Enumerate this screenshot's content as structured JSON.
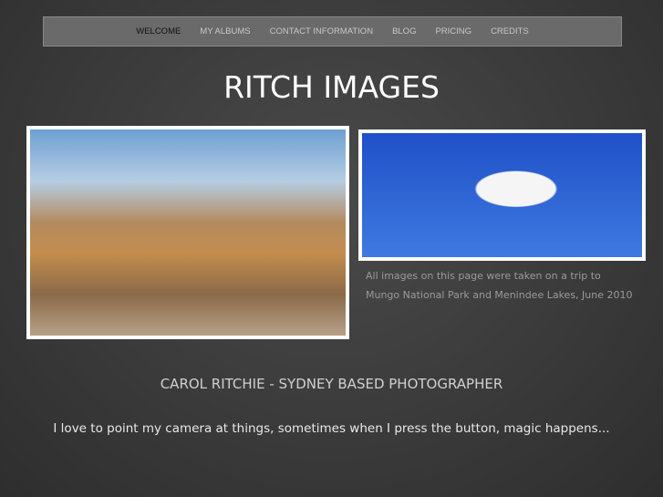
{
  "nav": {
    "items": [
      "WELCOME",
      "MY ALBUMS",
      "CONTACT INFORMATION",
      "BLOG",
      "PRICING",
      "CREDITS"
    ]
  },
  "site_title": "RITCH IMAGES",
  "caption": {
    "line1": "All images on this page were taken on a  trip to",
    "line2": "Mungo National Park and Menindee Lakes, June 2010"
  },
  "subtitle": "CAROL RITCHIE - SYDNEY BASED PHOTOGRAPHER",
  "tagline": "I love to point my camera at things, sometimes when I press the button, magic happens..."
}
